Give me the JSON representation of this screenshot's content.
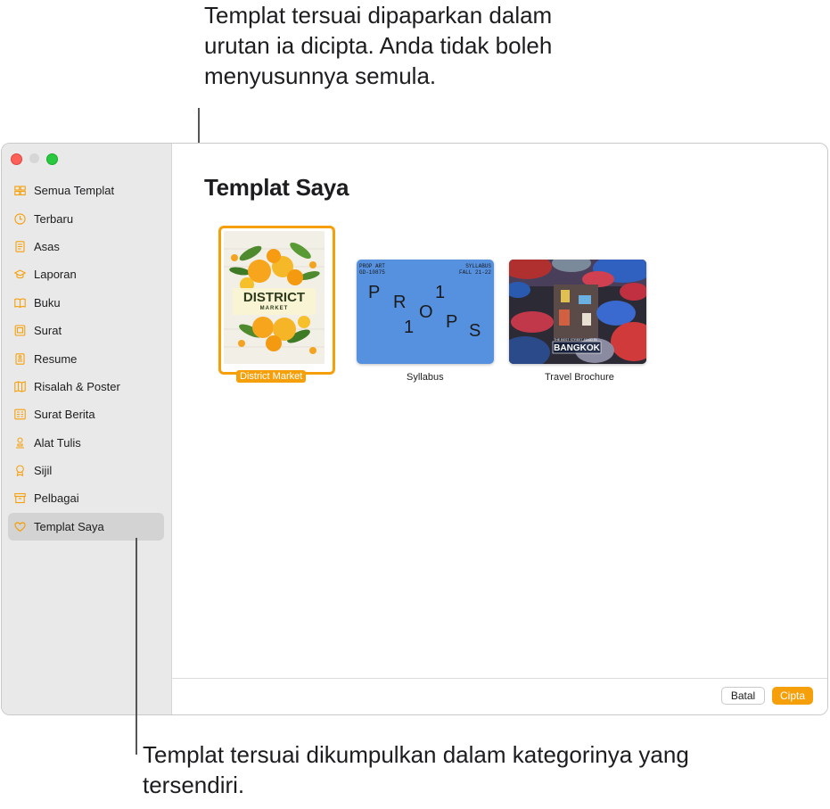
{
  "callouts": {
    "top": "Templat tersuai dipaparkan dalam urutan ia dicipta. Anda tidak boleh menyusunnya semula.",
    "bottom": "Templat tersuai dikumpulkan dalam kategorinya yang tersendiri."
  },
  "sidebar": {
    "items": [
      {
        "label": "Semua Templat",
        "icon": "grid-icon"
      },
      {
        "label": "Terbaru",
        "icon": "clock-icon"
      },
      {
        "label": "Asas",
        "icon": "document-icon"
      },
      {
        "label": "Laporan",
        "icon": "graduation-cap-icon"
      },
      {
        "label": "Buku",
        "icon": "book-icon"
      },
      {
        "label": "Surat",
        "icon": "letter-icon"
      },
      {
        "label": "Resume",
        "icon": "resume-icon"
      },
      {
        "label": "Risalah & Poster",
        "icon": "brochure-icon"
      },
      {
        "label": "Surat Berita",
        "icon": "newsletter-icon"
      },
      {
        "label": "Alat Tulis",
        "icon": "stationery-icon"
      },
      {
        "label": "Sijil",
        "icon": "ribbon-icon"
      },
      {
        "label": "Pelbagai",
        "icon": "archive-box-icon"
      },
      {
        "label": "Templat Saya",
        "icon": "heart-icon",
        "selected": true
      }
    ]
  },
  "main": {
    "title": "Templat Saya",
    "templates": [
      {
        "name": "District Market",
        "selected": true,
        "thumb": {
          "title": "DISTRICT",
          "subtitle": "MARKET"
        }
      },
      {
        "name": "Syllabus",
        "thumb": {
          "top_left": [
            "PROP ART",
            "GD-10875"
          ],
          "top_right": [
            "SYLLABUS",
            "FALL 21-22"
          ],
          "letters": [
            "P",
            "R",
            "1",
            "O",
            "1",
            "P",
            "S"
          ]
        }
      },
      {
        "name": "Travel Brochure",
        "thumb": {
          "tagline": "THE BEST STREET FOOD IN",
          "city": "BANGKOK"
        }
      }
    ]
  },
  "footer": {
    "cancel_label": "Batal",
    "create_label": "Cipta"
  },
  "colors": {
    "accent": "#f5a00a",
    "syllabus_bg": "#5691e0",
    "sidebar_bg": "#e9e9e9"
  }
}
